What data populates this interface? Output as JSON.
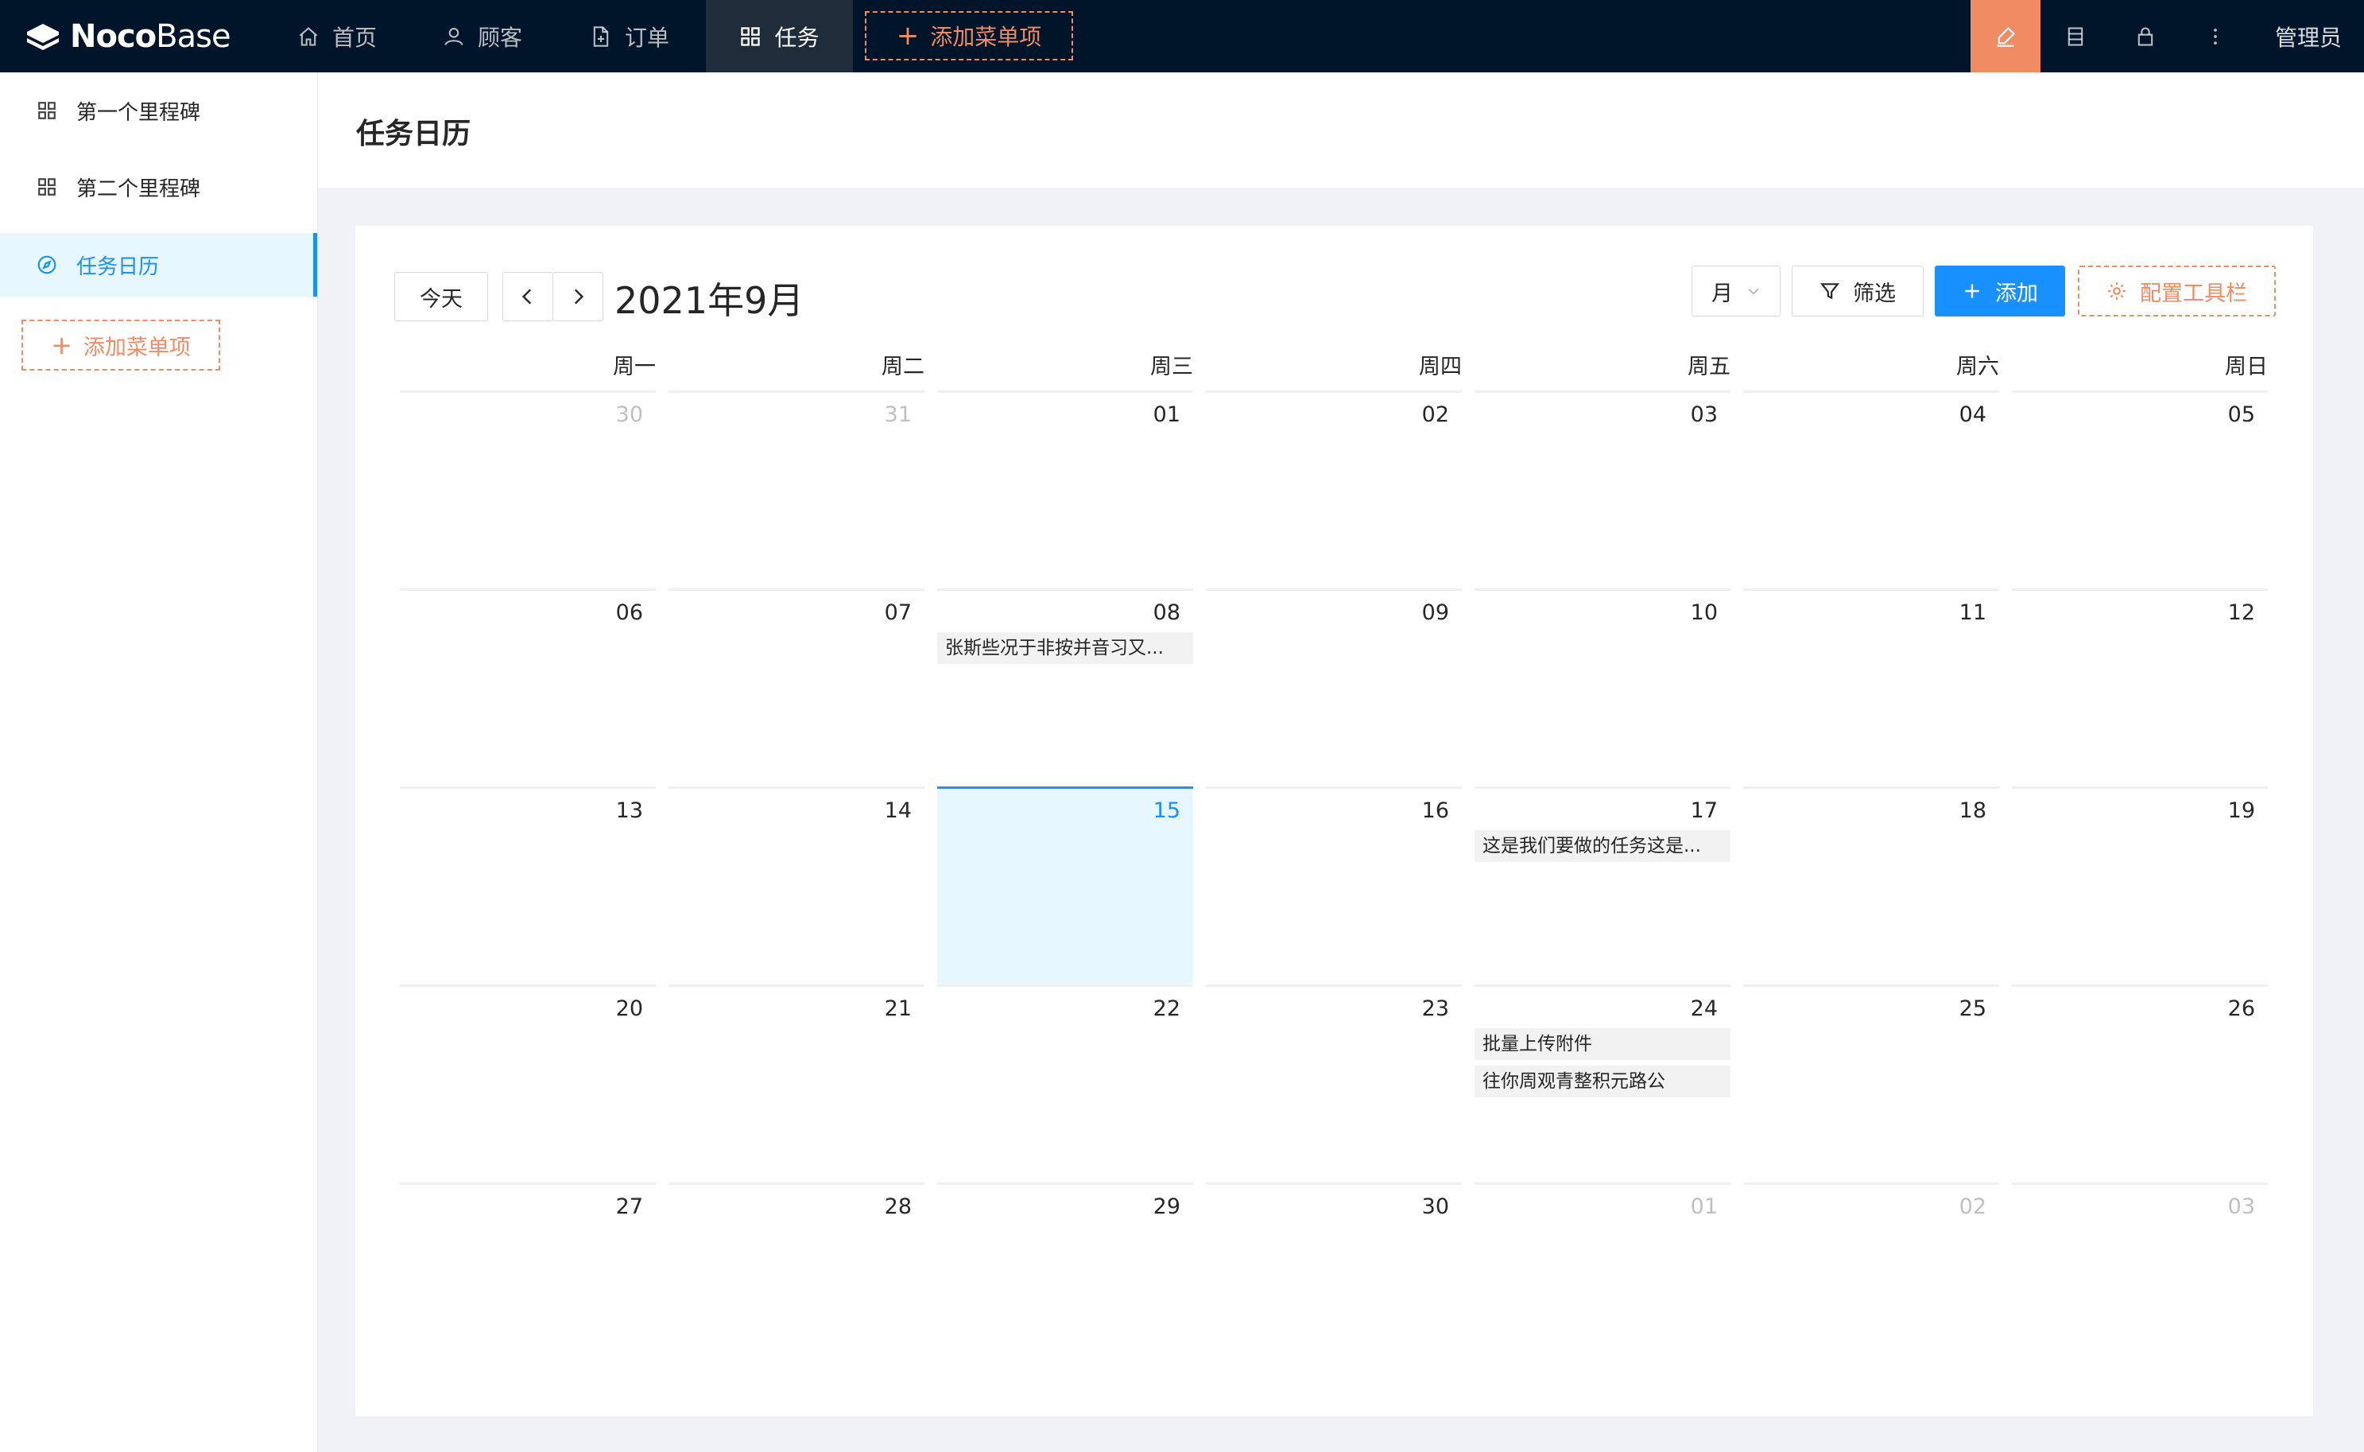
{
  "brand": {
    "part1": "Noco",
    "part2": "Base"
  },
  "topnav": {
    "items": [
      {
        "label": "首页",
        "icon": "home-icon"
      },
      {
        "label": "顾客",
        "icon": "user-icon"
      },
      {
        "label": "订单",
        "icon": "file-icon"
      },
      {
        "label": "任务",
        "icon": "appstore-icon",
        "active": true
      }
    ],
    "add_label": "添加菜单项",
    "user_label": "管理员"
  },
  "sidebar": {
    "items": [
      {
        "label": "第一个里程碑",
        "icon": "appstore-icon"
      },
      {
        "label": "第二个里程碑",
        "icon": "appstore-icon"
      },
      {
        "label": "任务日历",
        "icon": "compass-icon",
        "active": true
      }
    ],
    "add_label": "添加菜单项"
  },
  "page": {
    "title": "任务日历"
  },
  "calendar": {
    "today_label": "今天",
    "month_label": "2021年9月",
    "view_label": "月",
    "filter_label": "筛选",
    "add_label": "添加",
    "config_label": "配置工具栏",
    "weekdays": [
      "周一",
      "周二",
      "周三",
      "周四",
      "周五",
      "周六",
      "周日"
    ],
    "weeks": [
      [
        {
          "day": "30",
          "other": true
        },
        {
          "day": "31",
          "other": true
        },
        {
          "day": "01"
        },
        {
          "day": "02"
        },
        {
          "day": "03"
        },
        {
          "day": "04"
        },
        {
          "day": "05"
        }
      ],
      [
        {
          "day": "06"
        },
        {
          "day": "07"
        },
        {
          "day": "08",
          "events": [
            "张斯些况于非按并音习又..."
          ]
        },
        {
          "day": "09"
        },
        {
          "day": "10"
        },
        {
          "day": "11"
        },
        {
          "day": "12"
        }
      ],
      [
        {
          "day": "13"
        },
        {
          "day": "14"
        },
        {
          "day": "15",
          "today": true
        },
        {
          "day": "16"
        },
        {
          "day": "17",
          "events": [
            "这是我们要做的任务这是..."
          ]
        },
        {
          "day": "18"
        },
        {
          "day": "19"
        }
      ],
      [
        {
          "day": "20"
        },
        {
          "day": "21"
        },
        {
          "day": "22"
        },
        {
          "day": "23"
        },
        {
          "day": "24",
          "events": [
            "批量上传附件",
            "往你周观青整积元路公"
          ]
        },
        {
          "day": "25"
        },
        {
          "day": "26"
        }
      ],
      [
        {
          "day": "27"
        },
        {
          "day": "28"
        },
        {
          "day": "29"
        },
        {
          "day": "30"
        },
        {
          "day": "01",
          "other": true
        },
        {
          "day": "02",
          "other": true
        },
        {
          "day": "03",
          "other": true
        }
      ]
    ]
  },
  "colors": {
    "accent": "#f18b62",
    "primary": "#1890ff",
    "header_bg": "#001529",
    "today_bg": "#e6f7ff"
  }
}
